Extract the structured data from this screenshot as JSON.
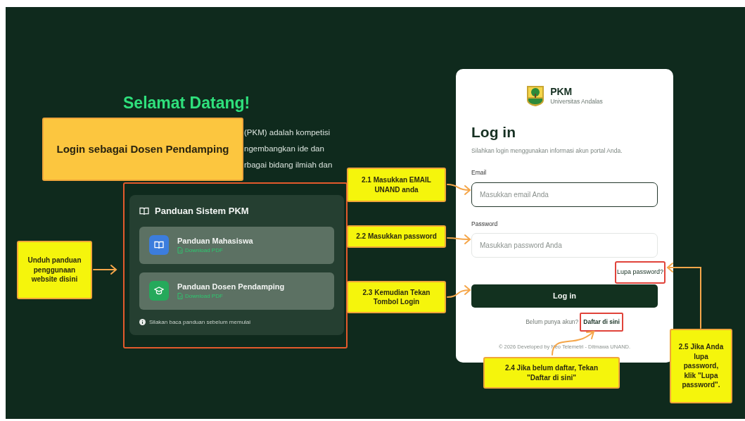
{
  "welcome": {
    "title": "Selamat Datang!",
    "intro_lines": [
      "(PKM) adalah kompetisi",
      "ngembangkan ide dan",
      "rbagai bidang ilmiah dan"
    ]
  },
  "guide": {
    "title": "Panduan Sistem PKM",
    "highlighted": true,
    "items": [
      {
        "title": "Panduan Mahasiswa",
        "link": "Download PDF",
        "kind": "student",
        "color": "#3c7ddd"
      },
      {
        "title": "Panduan Dosen Pendamping",
        "link": "Download PDF",
        "kind": "lecturer",
        "color": "#25a95b"
      }
    ],
    "note": "Silakan baca panduan sebelum memulai"
  },
  "login": {
    "brand": "PKM",
    "university": "Universitas Andalas",
    "heading": "Log in",
    "subtitle": "Silahkan login menggunakan informasi akun portal Anda.",
    "fields": [
      {
        "label": "Email",
        "placeholder": "Masukkan email Anda",
        "focused": true
      },
      {
        "label": "Password",
        "placeholder": "Masukkan password Anda",
        "focused": false
      }
    ],
    "forgot_link": {
      "text": "Lupa password?",
      "highlighted": true
    },
    "submit": "Log in",
    "signup_prompt": "Belum punya akun?",
    "signup_link": {
      "text": "Daftar di sini",
      "highlighted": true
    },
    "footer": "© 2026 Developed by Neo Telemetri - Ditmawa UNAND."
  },
  "callouts": [
    {
      "kind": "title",
      "text": "Login sebagai Dosen Pendamping"
    },
    {
      "kind": "note",
      "text": "Unduh panduan penggunaan website disini"
    },
    {
      "kind": "note",
      "text": "2.1 Masukkan EMAIL UNAND anda"
    },
    {
      "kind": "note",
      "text": "2.2 Masukkan password"
    },
    {
      "kind": "note",
      "text": "2.3 Kemudian Tekan Tombol Login"
    },
    {
      "kind": "note",
      "text": "2.4 Jika belum daftar, Tekan \"Daftar di sini\""
    },
    {
      "kind": "note",
      "text": "2.5 Jika Anda lupa password, klik \"Lupa password\"."
    }
  ]
}
